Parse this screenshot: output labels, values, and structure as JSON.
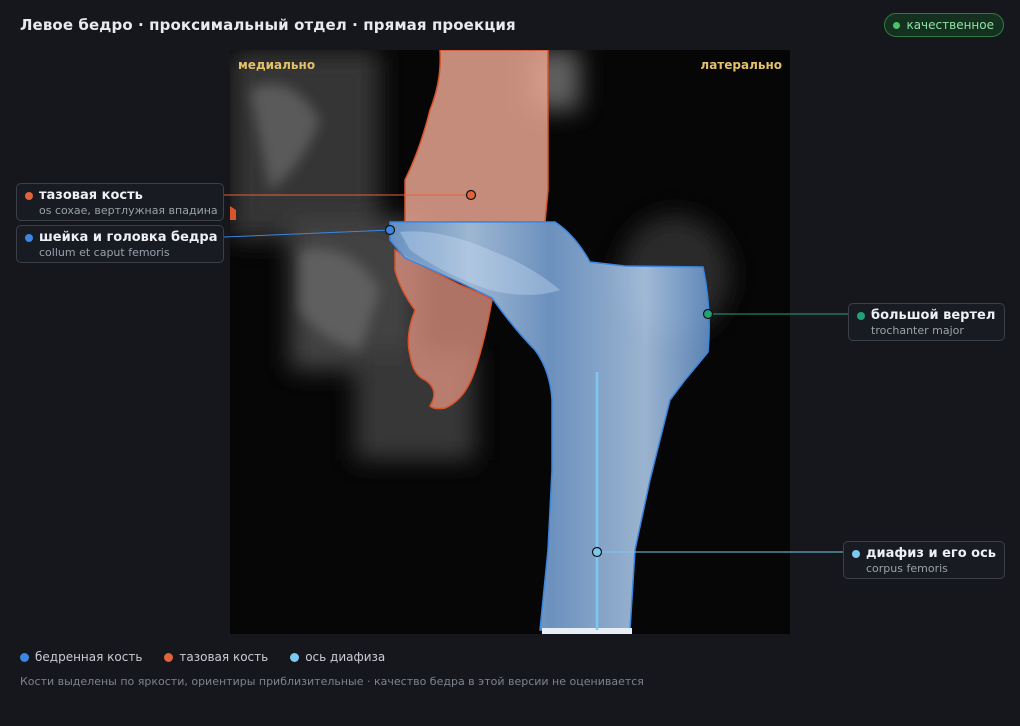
{
  "header": {
    "title": "Левое бедро · проксимальный отдел · прямая проекция",
    "quality_badge": "качественное"
  },
  "viewer": {
    "orient_medial": "медиально",
    "orient_lateral": "латерально"
  },
  "callouts": [
    {
      "name": "тазовая кость",
      "latin": "os coxae, вертлужная впадина",
      "color": "#e0633a"
    },
    {
      "name": "шейка и головка бедра",
      "latin": "collum et caput femoris",
      "color": "#3b86e0"
    },
    {
      "name": "большой вертел",
      "latin": "trochanter major",
      "color": "#22a07a"
    },
    {
      "name": "диафиз и его ось",
      "latin": "corpus femoris",
      "color": "#7cc8f0"
    }
  ],
  "legend": [
    {
      "label": "бедренная кость",
      "color": "#3b86e0"
    },
    {
      "label": "тазовая кость",
      "color": "#e0633a"
    },
    {
      "label": "ось диафиза",
      "color": "#7cc8f0"
    }
  ],
  "footnote": "Кости выделены по яркости, ориентиры приблизительные · качество бедра в этой версии не оценивается"
}
